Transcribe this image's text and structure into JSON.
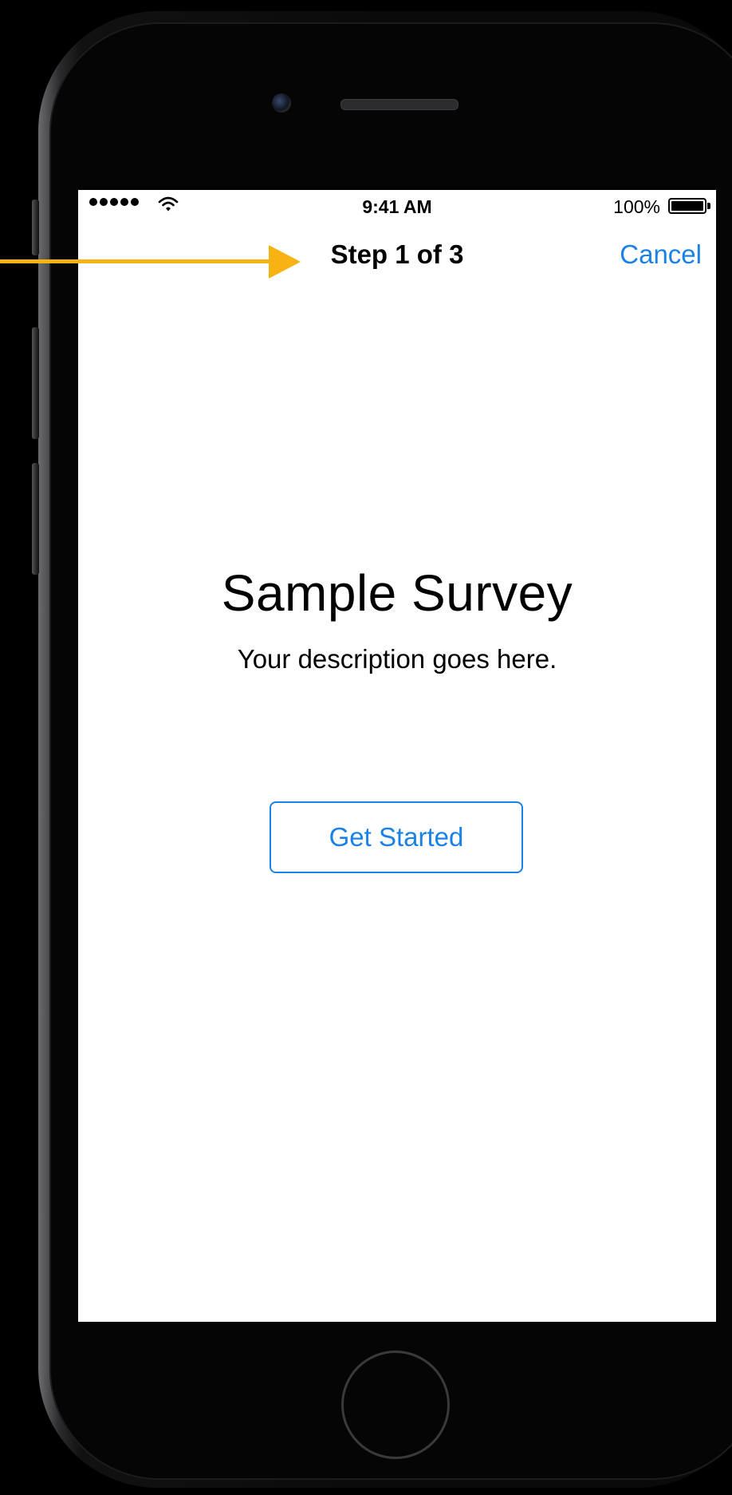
{
  "status_bar": {
    "time": "9:41 AM",
    "battery_percent": "100%",
    "signal_bars": 5,
    "battery_level": 1.0
  },
  "nav": {
    "title": "Step 1 of 3",
    "cancel_label": "Cancel"
  },
  "main": {
    "title": "Sample Survey",
    "description": "Your description goes here.",
    "get_started_label": "Get Started"
  },
  "colors": {
    "accent": "#1a82e6",
    "annotation_arrow": "#f7b313",
    "background": "#000000",
    "screen": "#ffffff"
  },
  "icons": {
    "signal": "signal-dots-icon",
    "wifi": "wifi-icon",
    "battery": "battery-icon",
    "arrow": "annotation-arrow-icon"
  }
}
